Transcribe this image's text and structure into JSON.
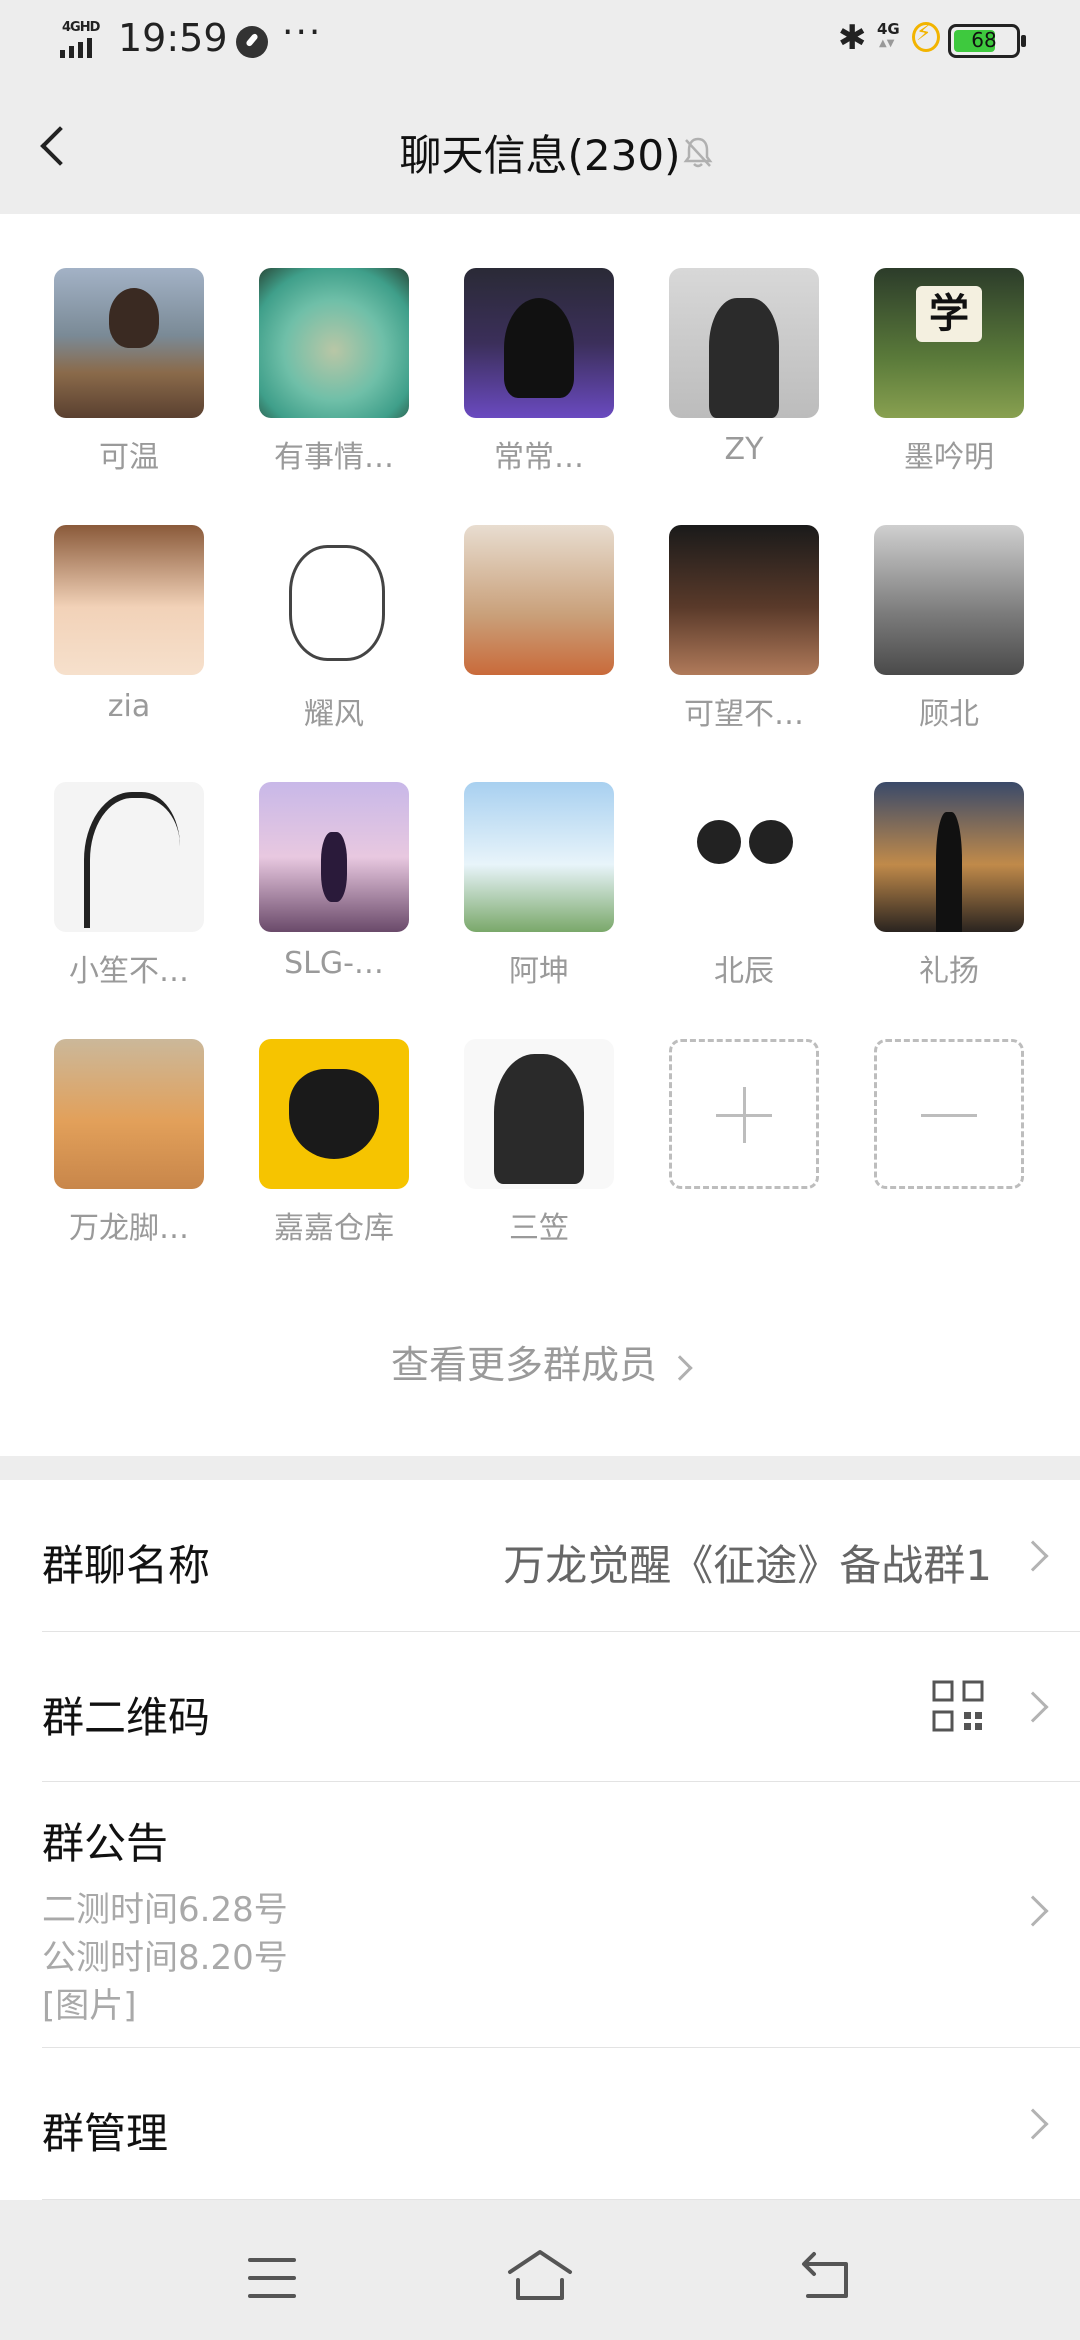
{
  "status_bar": {
    "network": "4GHD",
    "time": "19:59",
    "more": "···",
    "bluetooth": "✱",
    "network2": "4G",
    "battery": "68"
  },
  "header": {
    "title": "聊天信息(230)"
  },
  "members": [
    {
      "name": "可温"
    },
    {
      "name": "有事情…"
    },
    {
      "name": "常常…"
    },
    {
      "name": "ZY"
    },
    {
      "name": "墨吟明"
    },
    {
      "name": "zia"
    },
    {
      "name": "耀风"
    },
    {
      "name": ""
    },
    {
      "name": "可望不…"
    },
    {
      "name": "顾北"
    },
    {
      "name": "小笙不…"
    },
    {
      "name": "SLG-…"
    },
    {
      "name": "阿坤"
    },
    {
      "name": "北辰"
    },
    {
      "name": "礼扬"
    },
    {
      "name": "万龙脚…"
    },
    {
      "name": "嘉嘉仓库"
    },
    {
      "name": "三笠"
    }
  ],
  "avatar5_text": "学",
  "more_members": "查看更多群成员",
  "settings": {
    "group_name_label": "群聊名称",
    "group_name_value": "万龙觉醒《征途》备战群1",
    "qr_label": "群二维码",
    "notice_label": "群公告",
    "notice_lines": [
      "二测时间6.28号",
      "公测时间8.20号",
      "[图片]"
    ],
    "manage_label": "群管理"
  }
}
